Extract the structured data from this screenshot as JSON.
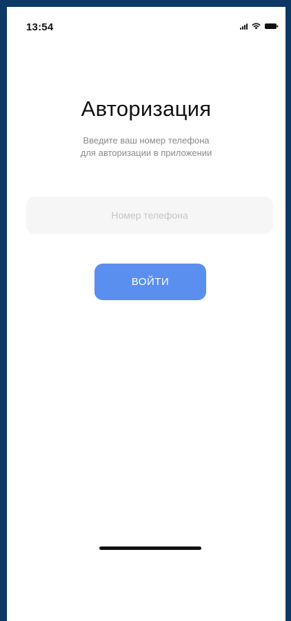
{
  "status_bar": {
    "time": "13:54",
    "icons": [
      "signal-icon",
      "wifi-icon",
      "battery-icon"
    ]
  },
  "auth": {
    "title": "Авторизация",
    "subtitle_line1": "Введите ваш номер телефона",
    "subtitle_line2": "для авторизации в приложении",
    "phone_placeholder": "Номер телефона",
    "phone_value": "",
    "login_label": "ВОЙТИ"
  },
  "colors": {
    "accent": "#5a8ff0",
    "frame": "#0b3864",
    "input_bg": "#f6f6f7",
    "subtitle_text": "#8a8a8a"
  }
}
